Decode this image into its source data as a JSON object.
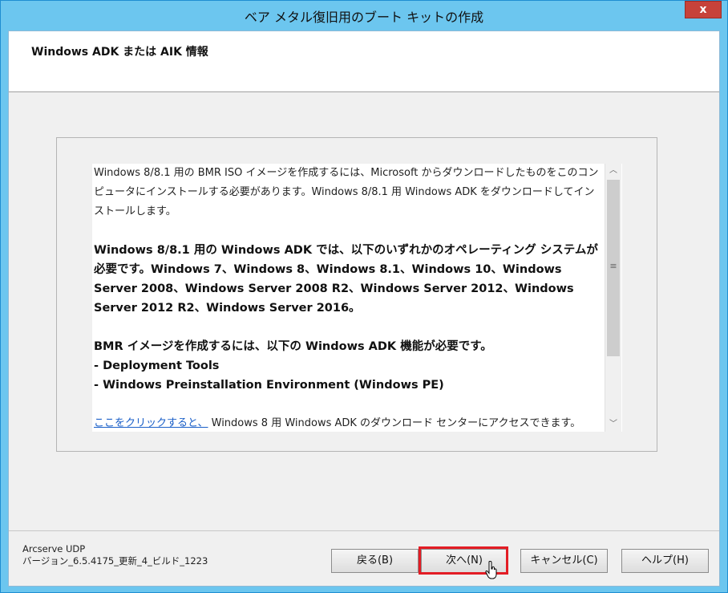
{
  "window": {
    "title": "ベア メタル復旧用のブート キットの作成",
    "close_label": "x"
  },
  "header": {
    "title": "Windows ADK または AIK 情報"
  },
  "content": {
    "para1": "Windows 8/8.1 用の BMR ISO イメージを作成するには、Microsoft からダウンロードしたものをこのコンピュータにインストールする必要があります。Windows 8/8.1 用 Windows ADK をダウンロードしてインストールします。",
    "para2": "Windows 8/8.1 用の Windows ADK では、以下のいずれかのオペレーティング システムが必要です。Windows 7、Windows 8、Windows 8.1、Windows 10、Windows Server 2008、Windows Server 2008 R2、Windows Server 2012、Windows Server 2012 R2、Windows Server 2016。",
    "para3_intro": "BMR イメージを作成するには、以下の Windows ADK 機能が必要です。",
    "feature1": "- Deployment Tools",
    "feature2": "- Windows Preinstallation Environment (Windows PE)",
    "link_text": "ここをクリックすると、",
    "link_suffix": "Windows 8 用 Windows ADK のダウンロード センターにアクセスできます。"
  },
  "scrollbar": {
    "up_arrow": "︿",
    "down_arrow": "﹀",
    "grip": "≡"
  },
  "footer": {
    "product": "Arcserve UDP",
    "version": "バージョン_6.5.4175_更新_4_ビルド_1223"
  },
  "buttons": {
    "back": "戻る(B)",
    "next": "次へ(N)",
    "cancel": "キャンセル(C)",
    "help": "ヘルプ(H)"
  },
  "colors": {
    "title_bar": "#6cc6ef",
    "close_button": "#c7423a",
    "highlight_box": "#e31d25",
    "link": "#1a5fc8"
  }
}
